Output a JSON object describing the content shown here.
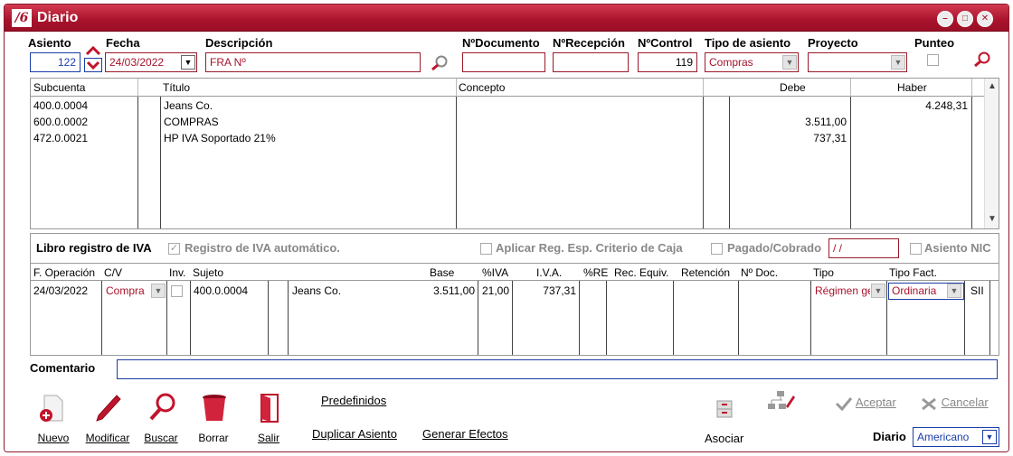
{
  "window": {
    "title": "Diario",
    "logo": "/6"
  },
  "header": {
    "asiento_label": "Asiento",
    "asiento_value": "122",
    "fecha_label": "Fecha",
    "fecha_value": "24/03/2022",
    "descripcion_label": "Descripción",
    "descripcion_value": "FRA Nº",
    "ndocumento_label": "NºDocumento",
    "ndocumento_value": "",
    "nrecepcion_label": "NºRecepción",
    "nrecepcion_value": "",
    "ncontrol_label": "NºControl",
    "ncontrol_value": "119",
    "tipo_asiento_label": "Tipo de asiento",
    "tipo_asiento_value": "Compras",
    "proyecto_label": "Proyecto",
    "proyecto_value": "",
    "punteo_label": "Punteo"
  },
  "entries": {
    "columns": [
      "Subcuenta",
      "Título",
      "Concepto",
      "Debe",
      "Haber"
    ],
    "rows": [
      {
        "subcuenta": "400.0.0004",
        "titulo": "Jeans Co.",
        "concepto": "",
        "debe": "",
        "haber": "4.248,31"
      },
      {
        "subcuenta": "600.0.0002",
        "titulo": "COMPRAS",
        "concepto": "",
        "debe": "3.511,00",
        "haber": ""
      },
      {
        "subcuenta": "472.0.0021",
        "titulo": "HP IVA Soportado 21%",
        "concepto": "",
        "debe": "737,31",
        "haber": ""
      }
    ]
  },
  "iva": {
    "title": "Libro registro de IVA",
    "registro_auto": "Registro de IVA automático.",
    "aplicar": "Aplicar Reg. Esp. Criterio de Caja",
    "pagado": "Pagado/Cobrado",
    "pagado_date": " /  /",
    "asiento_nic": "Asiento NIC",
    "columns": [
      "F. Operación",
      "C/V",
      "Inv.",
      "Sujeto",
      "Base",
      "%IVA",
      "I.V.A.",
      "%RE",
      "Rec. Equiv.",
      "Retención",
      "Nº Doc.",
      "Tipo",
      "Tipo Fact."
    ],
    "row": {
      "fecha": "24/03/2022",
      "cv": "Compra",
      "sujeto": "400.0.0004",
      "nombre": "Jeans Co.",
      "base": "3.511,00",
      "piva": "21,00",
      "iva": "737,31",
      "pre": "",
      "rec": "",
      "ret": "",
      "ndoc": "",
      "tipo": "Régimen ge",
      "tipo_fact": "Ordinaria",
      "sii": "SII"
    }
  },
  "comentario": {
    "label": "Comentario",
    "value": ""
  },
  "toolbar": {
    "nuevo": "Nuevo",
    "modificar": "Modificar",
    "buscar": "Buscar",
    "borrar": "Borrar",
    "salir": "Salir",
    "predefinidos": "Predefinidos",
    "duplicar": "Duplicar Asiento",
    "generar": "Generar Efectos",
    "asociar": "Asociar",
    "aceptar": "Aceptar",
    "cancelar": "Cancelar",
    "diario_label": "Diario",
    "diario_value": "Americano"
  },
  "colors": {
    "accent": "#a8122b",
    "field_border": "#9a1a2a",
    "blue": "#1a3ea8"
  }
}
